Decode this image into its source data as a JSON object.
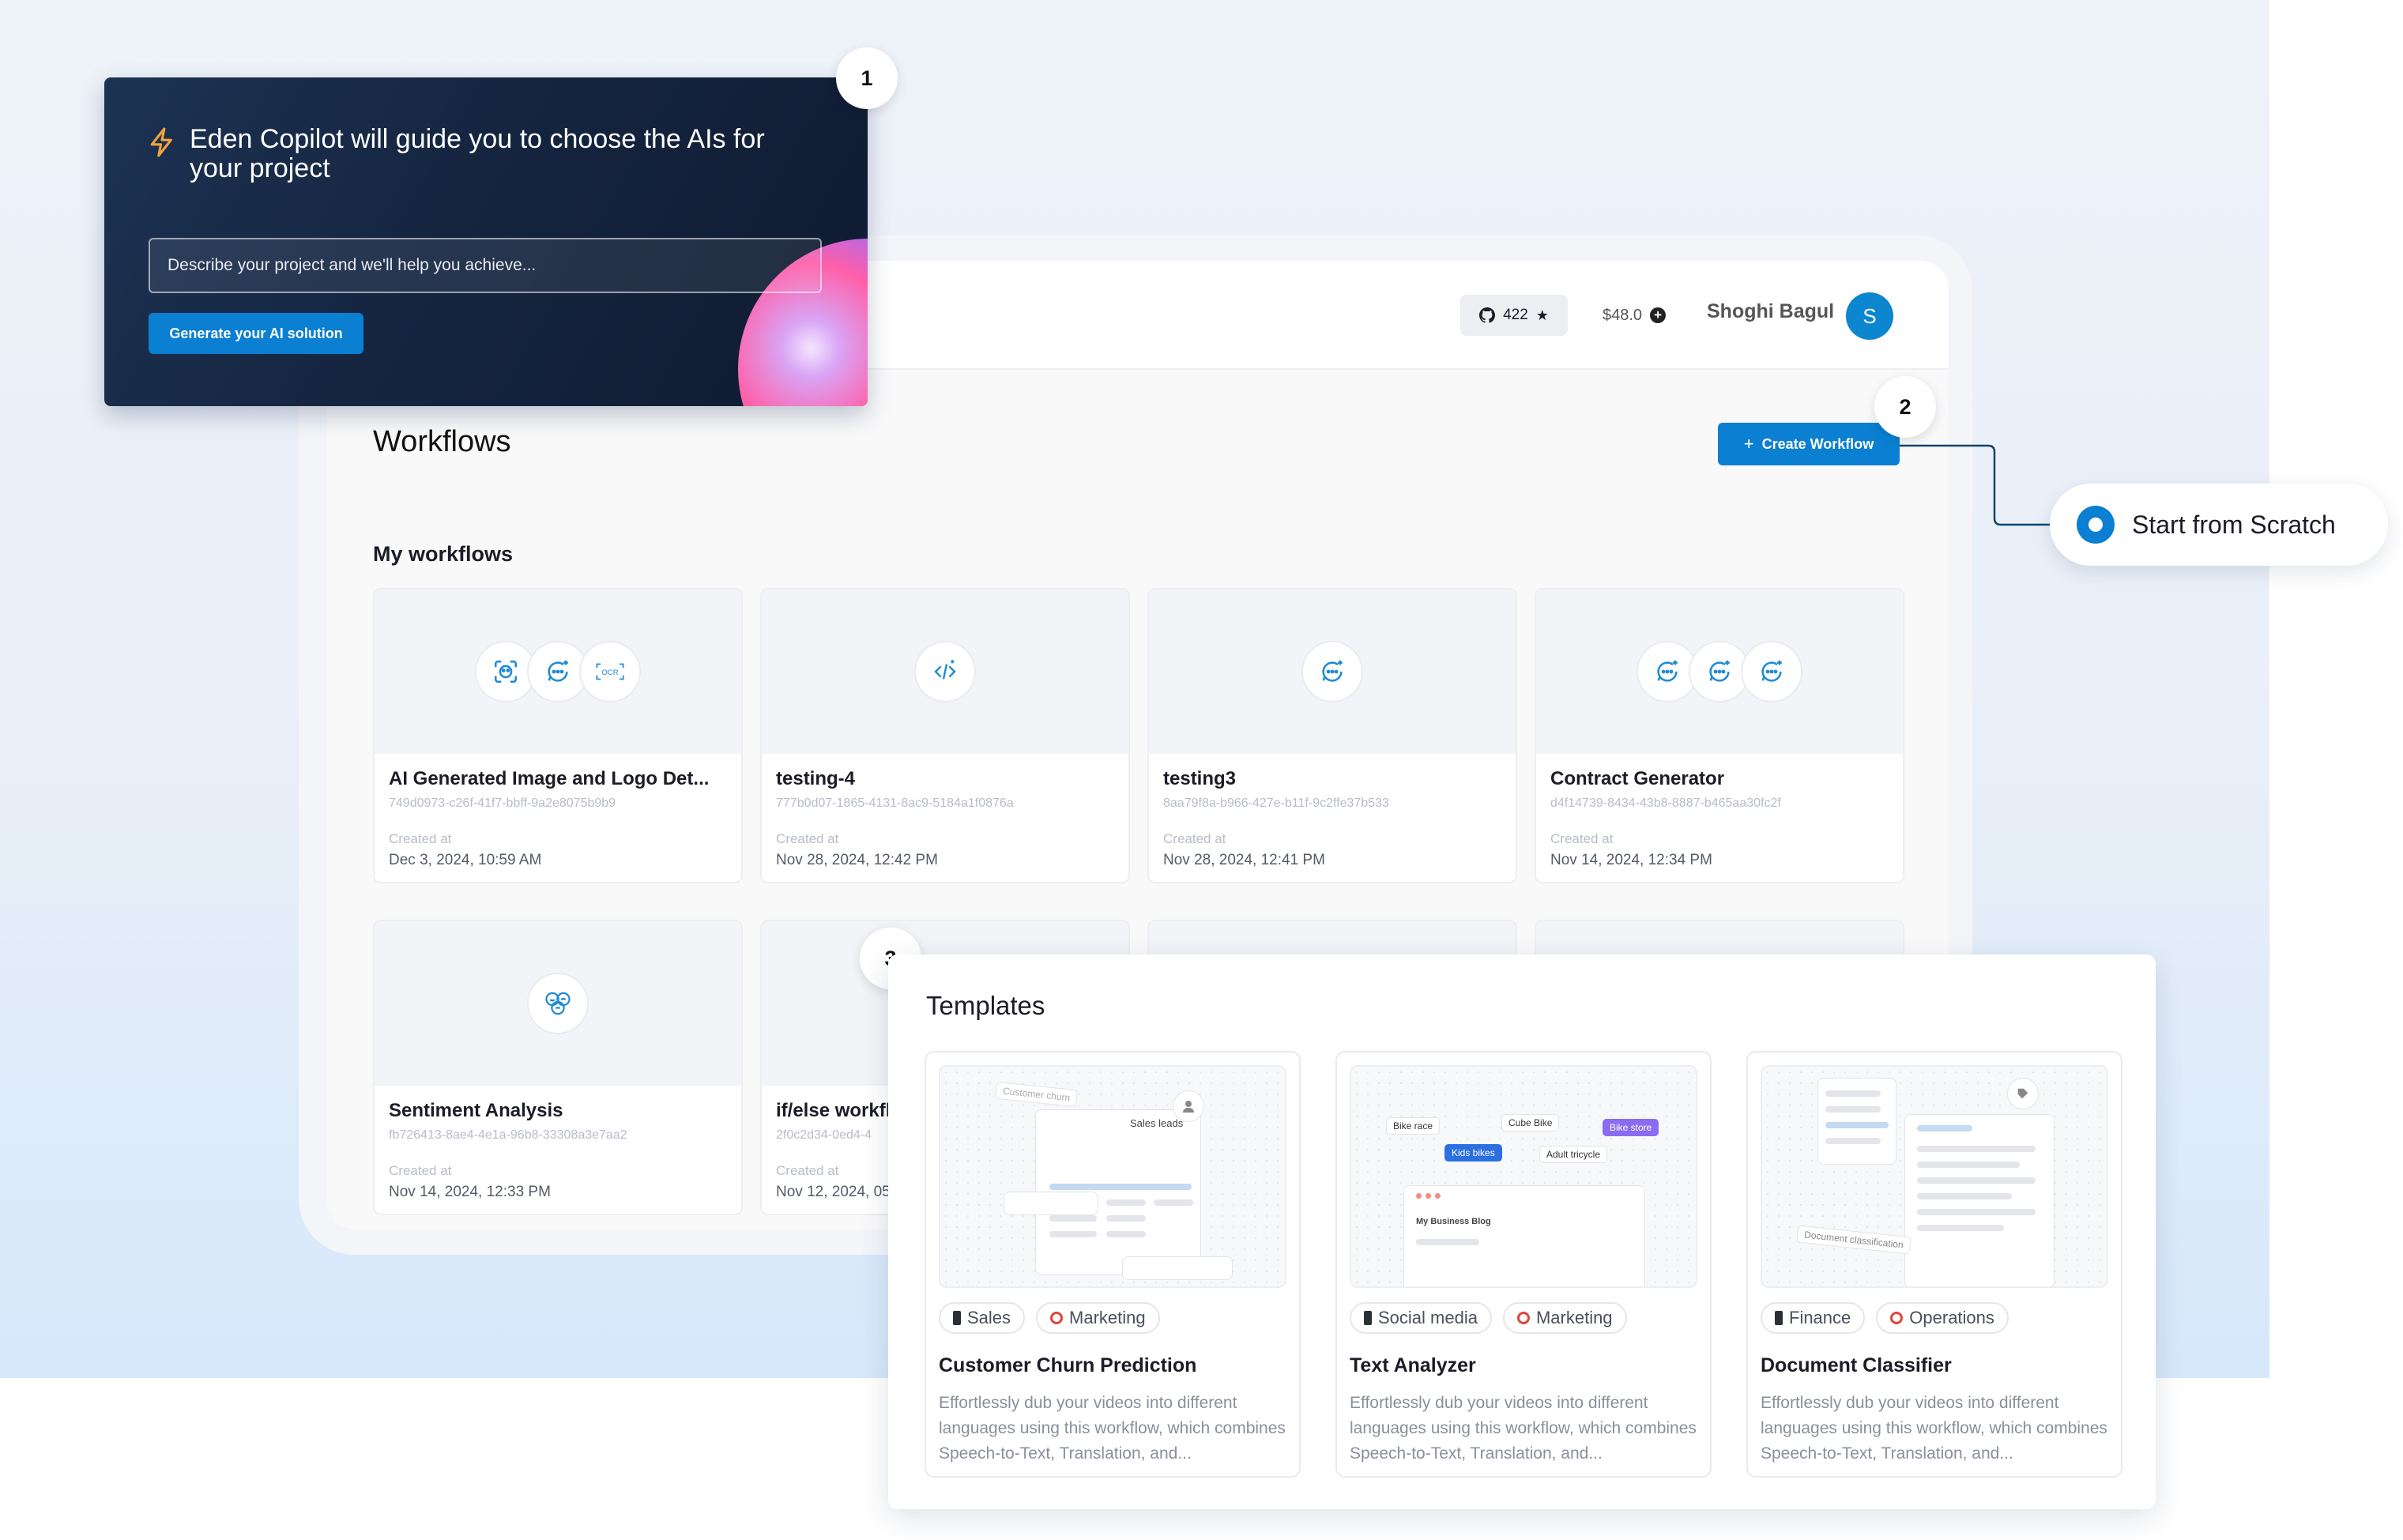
{
  "copilot": {
    "title": "Eden Copilot will guide you to choose the AIs for your project",
    "input_placeholder": "Describe your project and we'll help you achieve...",
    "button_label": "Generate your AI solution",
    "icon": "lightning-bolt-icon"
  },
  "header": {
    "github_stars": "422",
    "credits": "$48.0",
    "user_name": "Shoghi Bagul",
    "avatar_initial": "S"
  },
  "page": {
    "title": "Workflows",
    "create_button": "Create Workflow",
    "section_label": "My workflows"
  },
  "steps": [
    "1",
    "2",
    "3"
  ],
  "start_option": {
    "label": "Start from Scratch"
  },
  "workflows": [
    {
      "name": "AI Generated Image and Logo Det...",
      "id": "749d0973-c26f-41f7-bbff-9a2e8075b9b9",
      "created_label": "Created at",
      "created": "Dec 3, 2024, 10:59 AM",
      "icons": [
        "face-scan-icon",
        "chat-sparkle-icon",
        "ocr-icon"
      ]
    },
    {
      "name": "testing-4",
      "id": "777b0d07-1865-4131-8ac9-5184a1f0876a",
      "created_label": "Created at",
      "created": "Nov 28, 2024, 12:42 PM",
      "icons": [
        "code-sparkle-icon"
      ]
    },
    {
      "name": "testing3",
      "id": "8aa79f8a-b966-427e-b11f-9c2ffe37b533",
      "created_label": "Created at",
      "created": "Nov 28, 2024, 12:41 PM",
      "icons": [
        "chat-sparkle-icon"
      ]
    },
    {
      "name": "Contract Generator",
      "id": "d4f14739-8434-43b8-8887-b465aa30fc2f",
      "created_label": "Created at",
      "created": "Nov 14, 2024, 12:34 PM",
      "icons": [
        "chat-sparkle-icon",
        "chat-sparkle-icon",
        "chat-sparkle-icon"
      ]
    },
    {
      "name": "Sentiment Analysis",
      "id": "fb726413-8ae4-4e1a-96b8-33308a3e7aa2",
      "created_label": "Created at",
      "created": "Nov 14, 2024, 12:33 PM",
      "icons": [
        "sentiment-icon"
      ]
    },
    {
      "name": "if/else workfl",
      "id": "2f0c2d34-0ed4-4",
      "created_label": "Created at",
      "created": "Nov 12, 2024, 05:",
      "icons": []
    }
  ],
  "templates": {
    "heading": "Templates",
    "items": [
      {
        "name": "Customer Churn Prediction",
        "tags": [
          "Sales",
          "Marketing"
        ],
        "description": "Effortlessly dub your videos into different languages using this workflow, which combines Speech-to-Text, Translation, and...",
        "preview": {
          "chip1": "Customer churn",
          "chip2": "Sales leads"
        }
      },
      {
        "name": "Text Analyzer",
        "tags": [
          "Social media",
          "Marketing"
        ],
        "description": "Effortlessly dub your videos into different languages using this workflow, which combines Speech-to-Text, Translation, and...",
        "preview": {
          "chip1": "Bike race",
          "chip2": "Cube Bike",
          "chip3": "Bike store",
          "chip4": "Kids bikes",
          "chip5": "Adult tricycle",
          "blog": "My Business Blog"
        }
      },
      {
        "name": "Document Classifier",
        "tags": [
          "Finance",
          "Operations"
        ],
        "description": "Effortlessly dub your videos into different languages using this workflow, which combines Speech-to-Text, Translation, and...",
        "preview": {
          "chip1": "Document classification"
        }
      }
    ]
  },
  "colors": {
    "accent": "#0b7fd1",
    "copilot_bg": "#152540",
    "background": "#eef2f9"
  }
}
